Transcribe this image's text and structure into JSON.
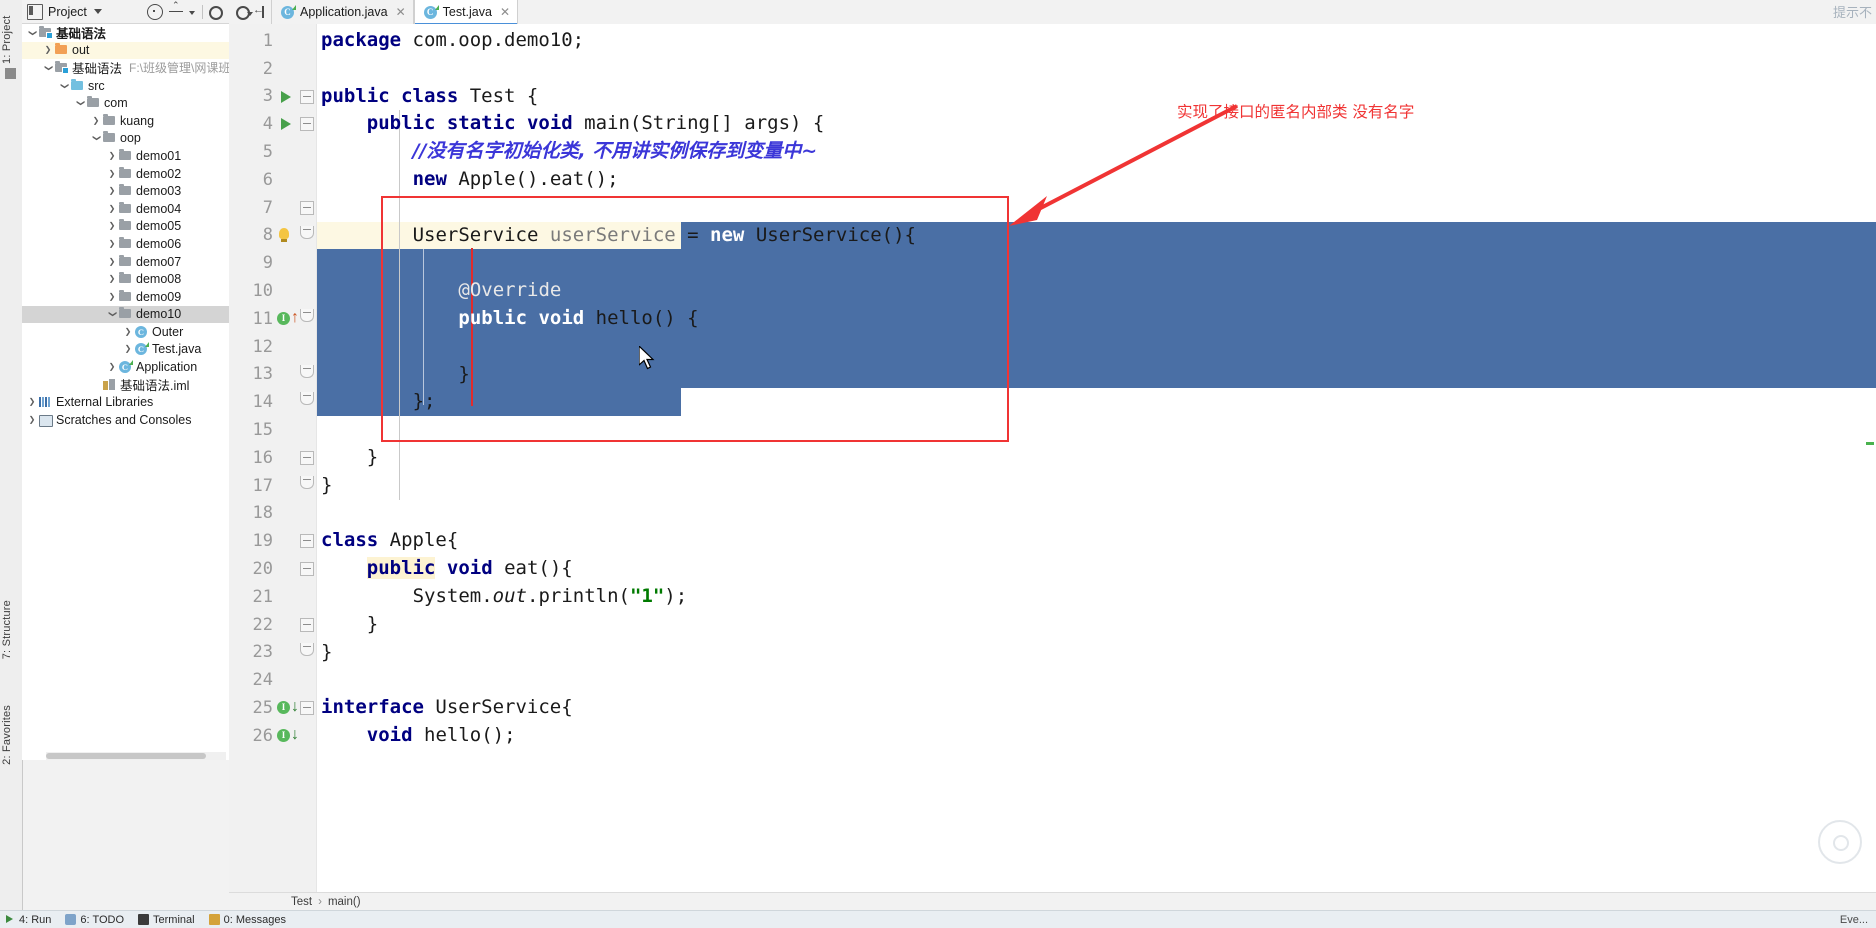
{
  "window": {
    "hint_right": "提示不"
  },
  "left_strips": [
    {
      "label": "1: Project",
      "name": "vertical-tab-project"
    },
    {
      "label": "7: Structure",
      "name": "vertical-tab-structure"
    },
    {
      "label": "2: Favorites",
      "name": "vertical-tab-favorites"
    }
  ],
  "project_panel": {
    "title": "Project",
    "tools": [
      "target-icon",
      "collapse-all-icon",
      "gear-icon"
    ],
    "tree": [
      {
        "depth": 0,
        "arrow": "down",
        "icon": "module-folder",
        "label": "基础语法",
        "bold": true,
        "path": "",
        "hl": "none"
      },
      {
        "depth": 1,
        "arrow": "right",
        "icon": "folder-orange",
        "label": "out",
        "bold": false,
        "path": "",
        "hl": "yellow"
      },
      {
        "depth": 1,
        "arrow": "down",
        "icon": "module-folder",
        "label": "基础语法",
        "bold": false,
        "path": "F:\\班级管理\\网课班\\代码\\Ja",
        "hl": "none"
      },
      {
        "depth": 2,
        "arrow": "down",
        "icon": "folder-blue",
        "label": "src",
        "bold": false,
        "path": "",
        "hl": "none"
      },
      {
        "depth": 3,
        "arrow": "down",
        "icon": "folder-gray",
        "label": "com",
        "bold": false,
        "path": "",
        "hl": "none"
      },
      {
        "depth": 4,
        "arrow": "right",
        "icon": "folder-gray",
        "label": "kuang",
        "bold": false,
        "path": "",
        "hl": "none"
      },
      {
        "depth": 4,
        "arrow": "down",
        "icon": "folder-gray",
        "label": "oop",
        "bold": false,
        "path": "",
        "hl": "none"
      },
      {
        "depth": 5,
        "arrow": "right",
        "icon": "folder-gray",
        "label": "demo01",
        "bold": false,
        "path": "",
        "hl": "none"
      },
      {
        "depth": 5,
        "arrow": "right",
        "icon": "folder-gray",
        "label": "demo02",
        "bold": false,
        "path": "",
        "hl": "none"
      },
      {
        "depth": 5,
        "arrow": "right",
        "icon": "folder-gray",
        "label": "demo03",
        "bold": false,
        "path": "",
        "hl": "none"
      },
      {
        "depth": 5,
        "arrow": "right",
        "icon": "folder-gray",
        "label": "demo04",
        "bold": false,
        "path": "",
        "hl": "none"
      },
      {
        "depth": 5,
        "arrow": "right",
        "icon": "folder-gray",
        "label": "demo05",
        "bold": false,
        "path": "",
        "hl": "none"
      },
      {
        "depth": 5,
        "arrow": "right",
        "icon": "folder-gray",
        "label": "demo06",
        "bold": false,
        "path": "",
        "hl": "none"
      },
      {
        "depth": 5,
        "arrow": "right",
        "icon": "folder-gray",
        "label": "demo07",
        "bold": false,
        "path": "",
        "hl": "none"
      },
      {
        "depth": 5,
        "arrow": "right",
        "icon": "folder-gray",
        "label": "demo08",
        "bold": false,
        "path": "",
        "hl": "none"
      },
      {
        "depth": 5,
        "arrow": "right",
        "icon": "folder-gray",
        "label": "demo09",
        "bold": false,
        "path": "",
        "hl": "none"
      },
      {
        "depth": 5,
        "arrow": "down",
        "icon": "folder-gray",
        "label": "demo10",
        "bold": false,
        "path": "",
        "hl": "gray"
      },
      {
        "depth": 6,
        "arrow": "right",
        "icon": "java-class",
        "label": "Outer",
        "bold": false,
        "path": "",
        "hl": "none"
      },
      {
        "depth": 6,
        "arrow": "right",
        "icon": "java-runnable",
        "label": "Test.java",
        "bold": false,
        "path": "",
        "hl": "none"
      },
      {
        "depth": 5,
        "arrow": "right",
        "icon": "java-runnable",
        "label": "Application",
        "bold": false,
        "path": "",
        "hl": "none"
      },
      {
        "depth": 4,
        "arrow": "none",
        "icon": "iml-file",
        "label": "基础语法.iml",
        "bold": false,
        "path": "",
        "hl": "none"
      },
      {
        "depth": 0,
        "arrow": "right",
        "icon": "libraries",
        "label": "External Libraries",
        "bold": false,
        "path": "",
        "hl": "none"
      },
      {
        "depth": 0,
        "arrow": "right",
        "icon": "scratches",
        "label": "Scratches and Consoles",
        "bold": false,
        "path": "",
        "hl": "none"
      }
    ]
  },
  "editor_tabs": [
    {
      "label": "Application.java",
      "icon": "java-runnable",
      "active": false,
      "closable": true
    },
    {
      "label": "Test.java",
      "icon": "java-runnable",
      "active": true,
      "closable": true
    }
  ],
  "code": {
    "lines": [
      {
        "num": "1",
        "indent": 0,
        "tokens": [
          {
            "t": "package ",
            "c": "kw"
          },
          {
            "t": "com.oop.demo10;",
            "c": "cls"
          }
        ]
      },
      {
        "num": "2",
        "indent": 0,
        "tokens": []
      },
      {
        "num": "3",
        "indent": 0,
        "tokens": [
          {
            "t": "public class ",
            "c": "kw"
          },
          {
            "t": "Test {",
            "c": "cls"
          }
        ]
      },
      {
        "num": "4",
        "indent": 1,
        "tokens": [
          {
            "t": "public static void ",
            "c": "kw"
          },
          {
            "t": "main(String[] args) {",
            "c": "cls"
          }
        ]
      },
      {
        "num": "5",
        "indent": 2,
        "tokens": [
          {
            "t": "//没有名字初始化类, 不用讲实例保存到变量中~",
            "c": "cmt-cn"
          }
        ]
      },
      {
        "num": "6",
        "indent": 2,
        "tokens": [
          {
            "t": "new ",
            "c": "kw"
          },
          {
            "t": "Apple().eat();",
            "c": "cls"
          }
        ]
      },
      {
        "num": "7",
        "indent": 0,
        "tokens": []
      },
      {
        "num": "8",
        "indent": 2,
        "tokens": [
          {
            "t": "UserService ",
            "c": "cls"
          },
          {
            "t": "userService",
            "c": "fld"
          },
          {
            "t": " = ",
            "c": "cls"
          }
        ],
        "sel_tokens": [
          {
            "t": "new ",
            "c": "kw"
          },
          {
            "t": "UserService(){",
            "c": "cls"
          }
        ]
      },
      {
        "num": "9",
        "indent": 0,
        "tokens": []
      },
      {
        "num": "10",
        "indent": 3,
        "sel": true,
        "tokens": [
          {
            "t": "@Override",
            "c": "ann"
          }
        ]
      },
      {
        "num": "11",
        "indent": 3,
        "sel": true,
        "tokens": [
          {
            "t": "public void ",
            "c": "kw"
          },
          {
            "t": "hello() {",
            "c": "cls"
          }
        ]
      },
      {
        "num": "12",
        "indent": 0,
        "sel": true,
        "tokens": []
      },
      {
        "num": "13",
        "indent": 3,
        "sel": true,
        "tokens": [
          {
            "t": "}",
            "c": "cls"
          }
        ]
      },
      {
        "num": "14",
        "indent": 2,
        "sel": true,
        "tokens": [
          {
            "t": "};",
            "c": "cls"
          }
        ]
      },
      {
        "num": "15",
        "indent": 0,
        "tokens": []
      },
      {
        "num": "16",
        "indent": 1,
        "tokens": [
          {
            "t": "}",
            "c": "cls"
          }
        ]
      },
      {
        "num": "17",
        "indent": 0,
        "tokens": [
          {
            "t": "}",
            "c": "cls"
          }
        ]
      },
      {
        "num": "18",
        "indent": 0,
        "tokens": []
      },
      {
        "num": "19",
        "indent": 0,
        "tokens": [
          {
            "t": "class ",
            "c": "kw"
          },
          {
            "t": "Apple{",
            "c": "cls"
          }
        ]
      },
      {
        "num": "20",
        "indent": 1,
        "tokens": [
          {
            "t": "public",
            "c": "kw hl-ident"
          },
          {
            "t": " ",
            "c": "cls"
          },
          {
            "t": "void ",
            "c": "kw"
          },
          {
            "t": "eat(){",
            "c": "cls"
          }
        ]
      },
      {
        "num": "21",
        "indent": 2,
        "tokens": [
          {
            "t": "System.",
            "c": "cls"
          },
          {
            "t": "out",
            "c": "stat"
          },
          {
            "t": ".println(",
            "c": "cls"
          },
          {
            "t": "\"1\"",
            "c": "str"
          },
          {
            "t": ");",
            "c": "cls"
          }
        ]
      },
      {
        "num": "22",
        "indent": 1,
        "tokens": [
          {
            "t": "}",
            "c": "cls"
          }
        ]
      },
      {
        "num": "23",
        "indent": 0,
        "tokens": [
          {
            "t": "}",
            "c": "cls"
          }
        ]
      },
      {
        "num": "24",
        "indent": 0,
        "tokens": []
      },
      {
        "num": "25",
        "indent": 0,
        "tokens": [
          {
            "t": "interface ",
            "c": "kw"
          },
          {
            "t": "UserService{",
            "c": "cls"
          }
        ]
      },
      {
        "num": "26",
        "indent": 1,
        "tokens": [
          {
            "t": "void ",
            "c": "kw"
          },
          {
            "t": "hello();",
            "c": "cls"
          }
        ]
      }
    ]
  },
  "annotation": {
    "text": "实现了接口的匿名内部类 没有名字",
    "color": "#f03434"
  },
  "breadcrumb": {
    "class": "Test",
    "method": "main()",
    "separator": "›"
  },
  "statusbar": {
    "items": [
      {
        "label": "4: Run",
        "icon": "run-icon"
      },
      {
        "label": "6: TODO",
        "icon": "todo-icon"
      },
      {
        "label": "Terminal",
        "icon": "terminal-icon"
      },
      {
        "label": "0: Messages",
        "icon": "messages-icon"
      }
    ],
    "right": "Eve..."
  },
  "colors": {
    "selection": "#4a6fa5",
    "annotation_red": "#f03434",
    "keyword_blue": "#000080",
    "comment_purple": "#3b36d8",
    "string_green": "#007a00",
    "line_highlight": "#fdf8e3"
  }
}
